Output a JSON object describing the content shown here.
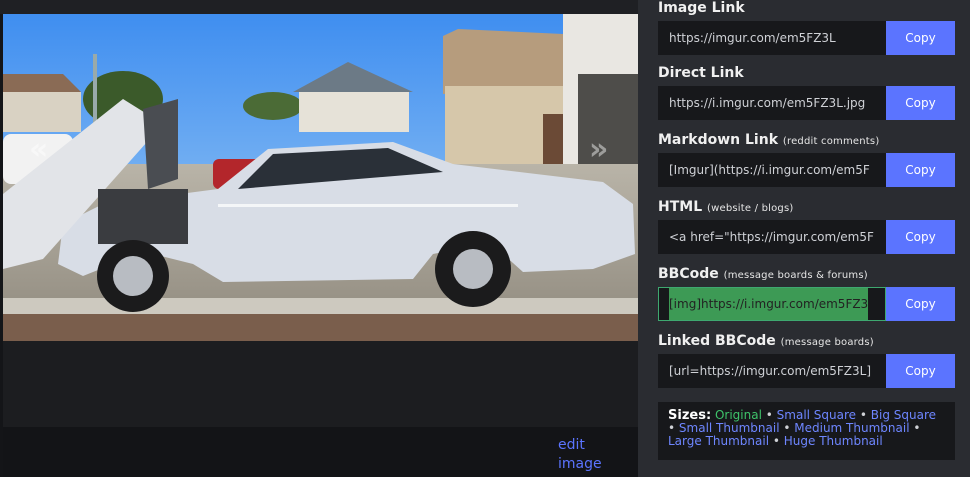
{
  "viewer": {
    "edit_label": "edit image",
    "prev_glyph": "«",
    "next_glyph": "»"
  },
  "share": {
    "image_link": {
      "label": "Image Link",
      "sub": "",
      "value": "https://imgur.com/em5FZ3L",
      "copy": "Copy"
    },
    "direct_link": {
      "label": "Direct Link",
      "sub": "",
      "value": "https://i.imgur.com/em5FZ3L.jpg",
      "copy": "Copy"
    },
    "markdown_link": {
      "label": "Markdown Link",
      "sub": "(reddit comments)",
      "value": "[Imgur](https://i.imgur.com/em5F",
      "copy": "Copy"
    },
    "html": {
      "label": "HTML",
      "sub": "(website / blogs)",
      "value": "<a href=\"https://imgur.com/em5F",
      "copy": "Copy"
    },
    "bbcode": {
      "label": "BBCode",
      "sub": "(message boards & forums)",
      "value": "[img]https://i.imgur.com/em5FZ3",
      "copy": "Copy"
    },
    "linked_bbcode": {
      "label": "Linked BBCode",
      "sub": "(message boards)",
      "value": "[url=https://imgur.com/em5FZ3L]",
      "copy": "Copy"
    }
  },
  "sizes": {
    "title": "Sizes:",
    "items": [
      "Original",
      "Small Square",
      "Big Square",
      "Small Thumbnail",
      "Medium Thumbnail",
      "Large Thumbnail",
      "Huge Thumbnail"
    ],
    "separator": " • "
  },
  "colors": {
    "accent": "#5b74ff",
    "selected_green": "#3ec36a",
    "panel_bg": "#2a2c31",
    "field_bg": "#17181b"
  }
}
